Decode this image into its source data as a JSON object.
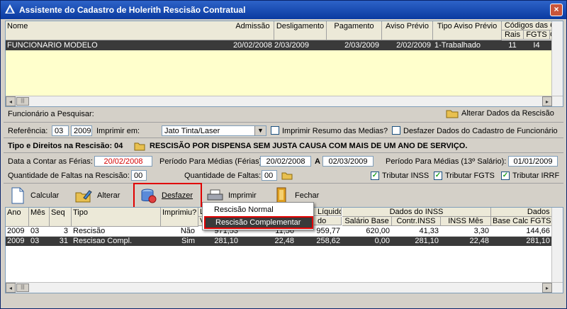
{
  "window": {
    "title": "Assistente do Cadastro de Holerith Rescisão Contratual",
    "close": "×"
  },
  "top_grid": {
    "headers": {
      "nome": "Nome",
      "admissao": "Admissão",
      "desligamento": "Desligamento",
      "pagamento": "Pagamento",
      "aviso": "Aviso  Prévio",
      "tipo_aviso": "Tipo Aviso Prévio",
      "codigos": "Códigos das Ca",
      "rais": "Rais",
      "fgts": "FGTS",
      "c": "C"
    },
    "row": {
      "nome": "FUNCIONARIO MODELO",
      "admissao": "20/02/2008",
      "desligamento": "2/03/2009",
      "pagamento": "2/03/2009",
      "aviso": "2/02/2009",
      "tipo_aviso": "1-Trabalhado",
      "rais": "11",
      "fgts": "I4"
    }
  },
  "search": {
    "label": "Funcionário a Pesquisar:",
    "alter_button": "Alterar Dados da Rescisão"
  },
  "referencia": {
    "label": "Referência:",
    "month": "03",
    "year": "2009",
    "imprimir_em_label": "Imprimir em:",
    "printer": "Jato Tinta/Laser",
    "chk_medias": "Imprimir  Resumo das Medias?",
    "chk_desfazer": "Desfazer Dados do Cadastro de Funcionário"
  },
  "tipo": {
    "label": "Tipo e Direitos na Rescisão: 04",
    "desc": "RESCISÃO POR DISPENSA SEM JUSTA CAUSA  COM MAIS  DE UM ANO DE SERVIÇO."
  },
  "datas": {
    "ferias_label": "Data a Contar as Férias:",
    "ferias_value": "20/02/2008",
    "periodo_ferias_label": "Período Para Médias (Férias):",
    "periodo_ferias_start": "20/02/2008",
    "a_label": "A",
    "periodo_ferias_end": "02/03/2009",
    "periodo13_label": "Período Para Médias (13º Salário):",
    "periodo13_value": "01/01/2009"
  },
  "faltas": {
    "rescisao_label": "Quantidade de Faltas na Rescisão:",
    "rescisao_value": "00",
    "faltas_label": "Quantidade de Faltas:",
    "faltas_value": "00",
    "tributar_inss": "Tributar INSS",
    "tributar_fgts": "Tributar FGTS",
    "tributar_irrf": "Tributar IRRF"
  },
  "toolbar": {
    "calcular": "Calcular",
    "alterar": "Alterar",
    "desfazer": "Desfazer",
    "imprimir": "Imprimir",
    "fechar": "Fechar"
  },
  "bottom_grid": {
    "headers": {
      "ano": "Ano",
      "mes": "Mês",
      "seq": "Seq",
      "tipo": "Tipo",
      "imprimiu": "Imprimiu?",
      "liquido": "Líquido",
      "dados_inss": "Dados do INSS",
      "dados_fgts": "Dados FG",
      "l": "L",
      "v": "V",
      "do": "do",
      "salario_base": "Salário Base",
      "contr_inss": "Contr.INSS",
      "inss_mes": "INSS Mês",
      "base_calc_fgts": "Base Calc FGTS",
      "f": "F"
    },
    "rows": [
      {
        "ano": "2009",
        "mes": "03",
        "seq": "3",
        "tipo": "Rescisão",
        "imprimiu": "Não",
        "col1": "971,53",
        "col2": "11,56",
        "liquido": "959,77",
        "salario_base": "620,00",
        "contr_inss": "41,33",
        "inss_mes": "3,30",
        "base_calc_fgts": "144,66"
      },
      {
        "ano": "2009",
        "mes": "03",
        "seq": "31",
        "tipo": "Rescisao Compl.",
        "imprimiu": "Sim",
        "col1": "281,10",
        "col2": "22,48",
        "liquido": "258,62",
        "salario_base": "0,00",
        "contr_inss": "281,10",
        "inss_mes": "22,48",
        "base_calc_fgts": "281,10"
      }
    ]
  },
  "context_menu": {
    "items": [
      "Rescisão Normal",
      "Rescisão Complementar"
    ]
  },
  "colors": {
    "title_bar": "#0a3aa0",
    "selected_row": "#3a3a3a",
    "highlight_box": "#e00000",
    "red_text": "#d40000",
    "yellow_row": "#ffffcc"
  }
}
